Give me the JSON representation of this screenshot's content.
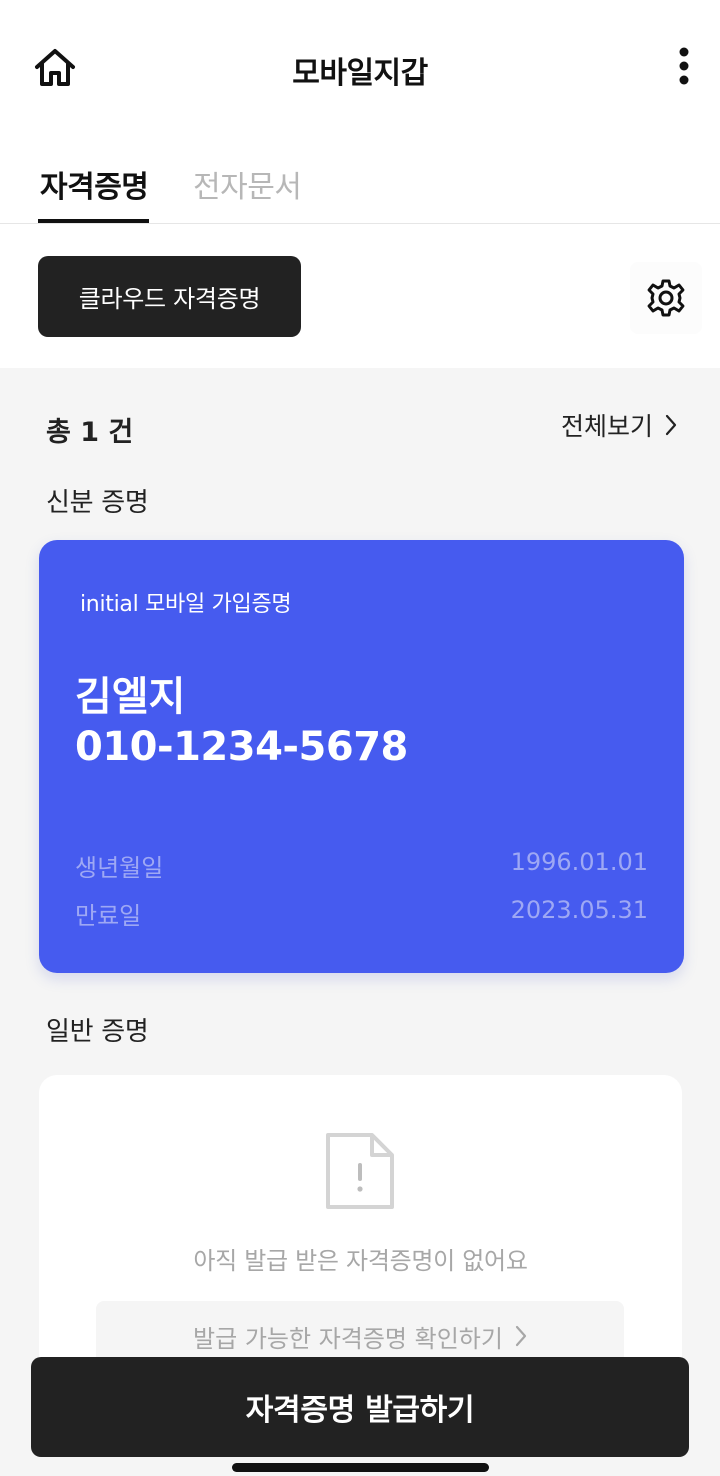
{
  "header": {
    "title": "모바일지갑",
    "left_icon": "home-icon",
    "right_icon": "more-vertical-icon"
  },
  "tabs": [
    {
      "label": "자격증명",
      "active": true
    },
    {
      "label": "전자문서",
      "active": false
    }
  ],
  "toolbar": {
    "cloud_label": "클라우드 자격증명",
    "settings_icon": "gear-icon"
  },
  "summary": {
    "count_label": "총 1 건",
    "view_all_label": "전체보기"
  },
  "sections": {
    "identity_label": "신분 증명",
    "general_label": "일반 증명"
  },
  "id_card": {
    "issuer": "initial 모바일 가입증명",
    "name": "김엘지",
    "phone": "010-1234-5678",
    "birth_label": "생년월일",
    "birth_value": "1996.01.01",
    "expire_label": "만료일",
    "expire_value": "2023.05.31",
    "color": "#465bef"
  },
  "empty_state": {
    "icon": "document-alert-icon",
    "message": "아직 발급 받은 자격증명이 없어요",
    "action_label": "발급 가능한 자격증명 확인하기"
  },
  "footer": {
    "issue_label": "자격증명 발급하기"
  },
  "colors": {
    "accent_dark": "#222222",
    "card_blue": "#465bef",
    "background_gray": "#f5f5f5",
    "muted_text": "#a7a7a7"
  }
}
